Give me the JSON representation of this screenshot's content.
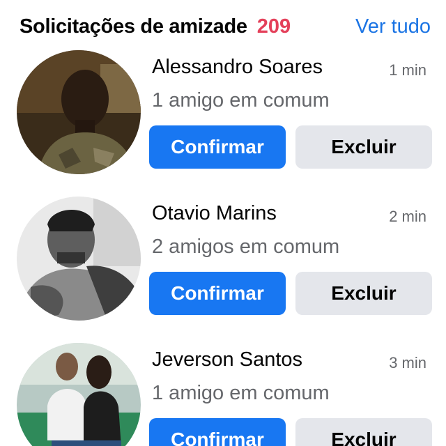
{
  "header": {
    "title": "Solicitações de amizade",
    "count": "209",
    "see_all": "Ver tudo"
  },
  "requests": [
    {
      "name": "Alessandro Soares",
      "time": "1 min",
      "mutual": "1 amigo em comum",
      "confirm_label": "Confirmar",
      "delete_label": "Excluir"
    },
    {
      "name": "Otavio Marins",
      "time": "2 min",
      "mutual": "2 amigos em comum",
      "confirm_label": "Confirmar",
      "delete_label": "Excluir"
    },
    {
      "name": "Jeverson Santos",
      "time": "3 min",
      "mutual": "1 amigo em comum",
      "confirm_label": "Confirmar",
      "delete_label": "Excluir"
    }
  ],
  "colors": {
    "accent": "#1877f2",
    "link": "#1b74e4",
    "count": "#e4405a",
    "secondary_button": "#e4e6eb",
    "muted_text": "#65676b"
  }
}
